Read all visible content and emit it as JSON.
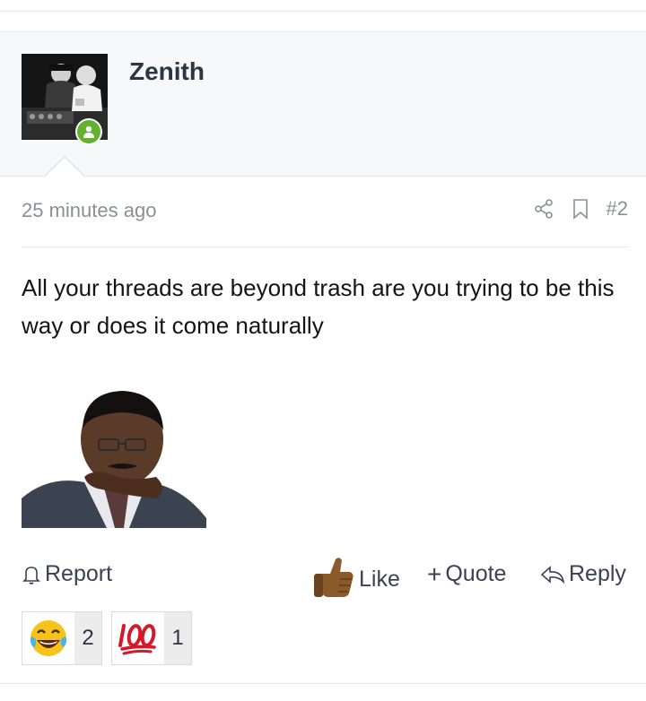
{
  "post": {
    "username": "Zenith",
    "timestamp": "25 minutes ago",
    "post_number": "#2",
    "message": "All your threads are beyond trash are you trying to be this way or does it come naturally",
    "status": "online"
  },
  "actions": {
    "report": "Report",
    "like": "Like",
    "quote": "Quote",
    "reply": "Reply"
  },
  "reactions": [
    {
      "icon": "laughing-crying-emoji",
      "count": "2"
    },
    {
      "icon": "hundred-points-emoji",
      "count": "1"
    }
  ],
  "colors": {
    "online_green": "#63b12c",
    "username": "#2f3441",
    "muted_text": "#8a8f96"
  }
}
